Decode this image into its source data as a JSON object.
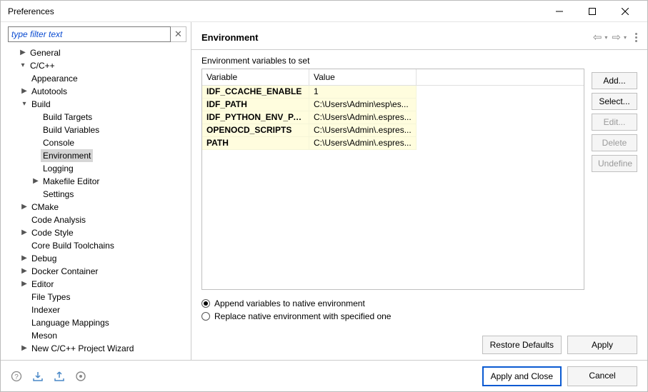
{
  "window": {
    "title": "Preferences"
  },
  "filter": {
    "placeholder": "type filter text"
  },
  "tree": {
    "general": "General",
    "ccpp": "C/C++",
    "appearance": "Appearance",
    "autotools": "Autotools",
    "build": "Build",
    "build_targets": "Build Targets",
    "build_variables": "Build Variables",
    "console": "Console",
    "environment": "Environment",
    "logging": "Logging",
    "makefile_editor": "Makefile Editor",
    "settings": "Settings",
    "cmake": "CMake",
    "code_analysis": "Code Analysis",
    "code_style": "Code Style",
    "core_build": "Core Build Toolchains",
    "debug": "Debug",
    "docker": "Docker Container",
    "editor": "Editor",
    "file_types": "File Types",
    "indexer": "Indexer",
    "lang_map": "Language Mappings",
    "meson": "Meson",
    "new_proj": "New C/C++ Project Wizard"
  },
  "main": {
    "title": "Environment",
    "table_label": "Environment variables to set",
    "headers": {
      "variable": "Variable",
      "value": "Value"
    },
    "rows": [
      {
        "variable": "IDF_CCACHE_ENABLE",
        "value": "1"
      },
      {
        "variable": "IDF_PATH",
        "value": "C:\\Users\\Admin\\esp\\es..."
      },
      {
        "variable": "IDF_PYTHON_ENV_PATH",
        "value": "C:\\Users\\Admin\\.espres..."
      },
      {
        "variable": "OPENOCD_SCRIPTS",
        "value": "C:\\Users\\Admin\\.espres..."
      },
      {
        "variable": "PATH",
        "value": "C:\\Users\\Admin\\.espres..."
      }
    ],
    "buttons": {
      "add": "Add...",
      "select": "Select...",
      "edit": "Edit...",
      "delete": "Delete",
      "undefine": "Undefine"
    },
    "radios": {
      "append": "Append variables to native environment",
      "replace": "Replace native environment with specified one"
    },
    "actions": {
      "restore": "Restore Defaults",
      "apply": "Apply"
    }
  },
  "footer": {
    "apply_close": "Apply and Close",
    "cancel": "Cancel"
  }
}
